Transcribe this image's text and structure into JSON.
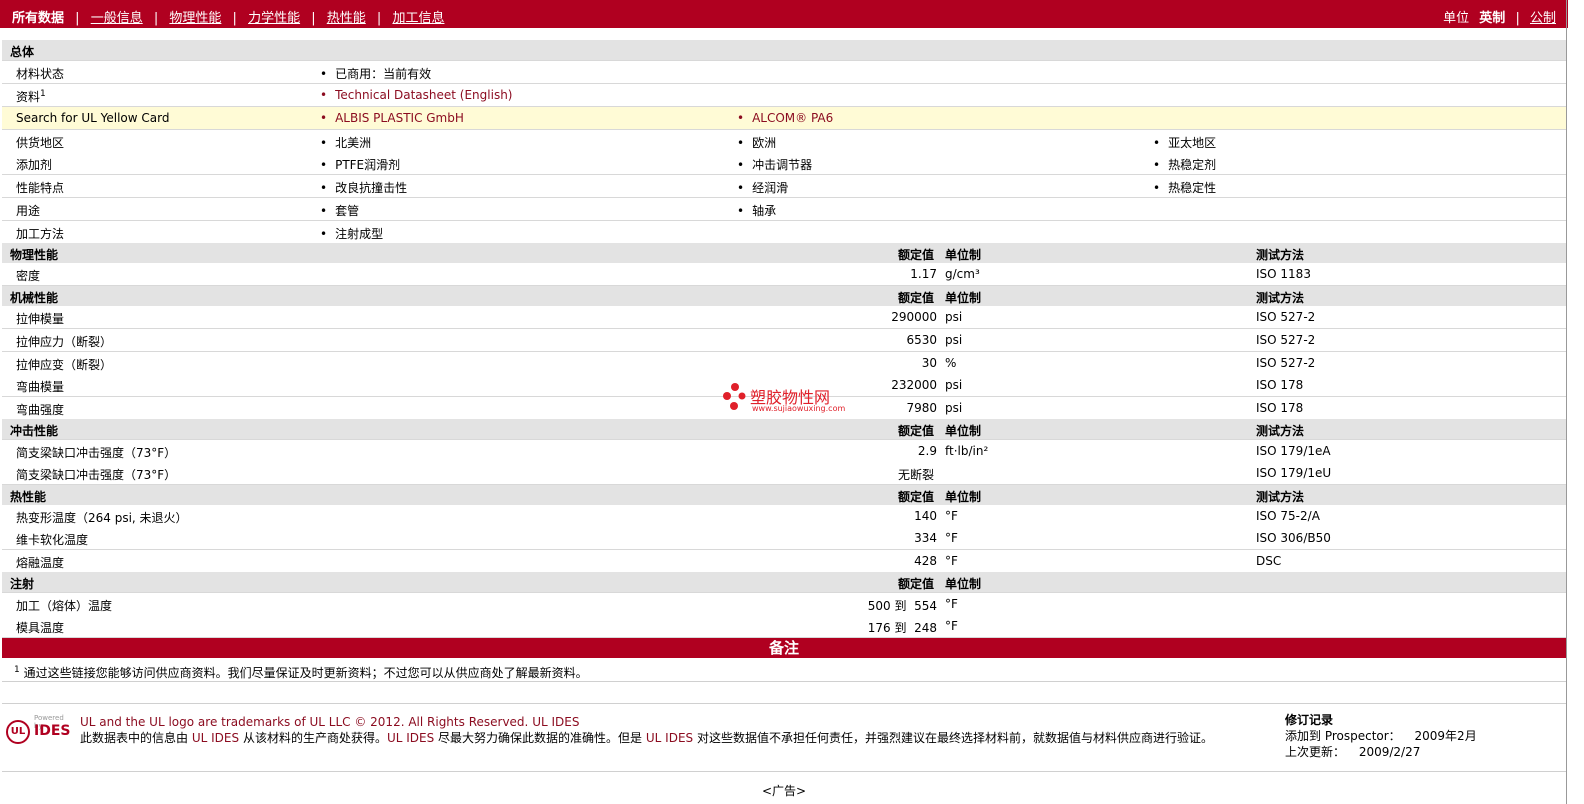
{
  "nav": {
    "all_data": "所有数据",
    "sep": "|",
    "links": [
      "一般信息",
      "物理性能",
      "力学性能",
      "热性能",
      "加工信息"
    ]
  },
  "units": {
    "label": "单位",
    "selected": "英制",
    "sep": "|",
    "other": "公制"
  },
  "general": {
    "title": "总体",
    "status_label": "材料状态",
    "status_value": "已商用：当前有效",
    "resource_label": "资料",
    "resource_sup": "1",
    "resource_link": "Technical Datasheet (English)",
    "ul_label": "Search for UL Yellow Card",
    "ul_link1": "ALBIS PLASTIC GmbH",
    "ul_link2": "ALCOM® PA6",
    "supply_label": "供货地区",
    "supply": [
      "北美洲",
      "欧洲",
      "亚太地区"
    ],
    "additive_label": "添加剂",
    "additives": [
      "PTFE润滑剂",
      "冲击调节器",
      "热稳定剂"
    ],
    "feature_label": "性能特点",
    "features": [
      "改良抗撞击性",
      "经润滑",
      "热稳定性"
    ],
    "use_label": "用途",
    "uses": [
      "套管",
      "轴承"
    ],
    "process_label": "加工方法",
    "process": [
      "注射成型"
    ]
  },
  "col_headers": {
    "value": "额定值",
    "unit": "单位制",
    "method": "测试方法"
  },
  "physical": {
    "title": "物理性能",
    "rows": [
      {
        "name": "密度",
        "value": "1.17",
        "unit": "g/cm³",
        "method": "ISO 1183"
      }
    ]
  },
  "mechanical": {
    "title": "机械性能",
    "rows": [
      {
        "name": "拉伸模量",
        "value": "290000",
        "unit": "psi",
        "method": "ISO 527-2"
      },
      {
        "name": "拉伸应力（断裂）",
        "value": "6530",
        "unit": "psi",
        "method": "ISO 527-2"
      },
      {
        "name": "拉伸应变（断裂）",
        "value": "30",
        "unit": "%",
        "method": "ISO 527-2"
      },
      {
        "name": "弯曲模量",
        "value": "232000",
        "unit": "psi",
        "method": "ISO 178"
      },
      {
        "name": "弯曲强度",
        "value": "7980",
        "unit": "psi",
        "method": "ISO 178"
      }
    ]
  },
  "impact": {
    "title": "冲击性能",
    "rows": [
      {
        "name": "简支梁缺口冲击强度（73°F）",
        "value": "2.9",
        "unit": "ft·lb/in²",
        "method": "ISO 179/1eA"
      },
      {
        "name": "简支梁缺口冲击强度（73°F）",
        "value": "无断裂",
        "unit": "",
        "method": "ISO 179/1eU"
      }
    ]
  },
  "thermal": {
    "title": "热性能",
    "rows": [
      {
        "name": "热变形温度（264 psi, 未退火）",
        "value": "140",
        "unit": "°F",
        "method": "ISO 75-2/A"
      },
      {
        "name": "维卡软化温度",
        "value": "334",
        "unit": "°F",
        "method": "ISO 306/B50"
      },
      {
        "name": "熔融温度",
        "value": "428",
        "unit": "°F",
        "method": "DSC"
      }
    ]
  },
  "injection": {
    "title": "注射",
    "rows": [
      {
        "name": "加工（熔体）温度",
        "value": "500 到  554",
        "unit": "°F",
        "method": ""
      },
      {
        "name": "模具温度",
        "value": "176 到  248",
        "unit": "°F",
        "method": ""
      }
    ]
  },
  "notes": {
    "title": "备注",
    "sup": "1",
    "text": "通过这些链接您能够访问供应商资料。我们尽量保证及时更新资料；不过您可以从供应商处了解最新资料。"
  },
  "watermark": {
    "text": "塑胶物性网",
    "sub": "www.sujiaowuxing.com"
  },
  "footer": {
    "logo_top": "Powered by",
    "logo_ul": "UL",
    "logo_ides": "IDES",
    "trademark": "UL and the UL logo are trademarks of UL LLC © 2012. All Rights Reserved.",
    "ul_ides": "UL IDES",
    "disc_p1": "此数据表中的信息由",
    "disc_p2": "从该材料的生产商处获得。",
    "disc_p3": "尽最大努力确保此数据的准确性。但是",
    "disc_p4": "对这些数据值不承担任何责任，并强烈建议在最终选择材料前，就数据值与材料供应商进行验证。",
    "rev_title": "修订记录",
    "added_label": "添加到 Prospector：",
    "added_value": "2009年2月",
    "updated_label": "上次更新：",
    "updated_value": "2009/2/27"
  },
  "ad": "<广告>"
}
